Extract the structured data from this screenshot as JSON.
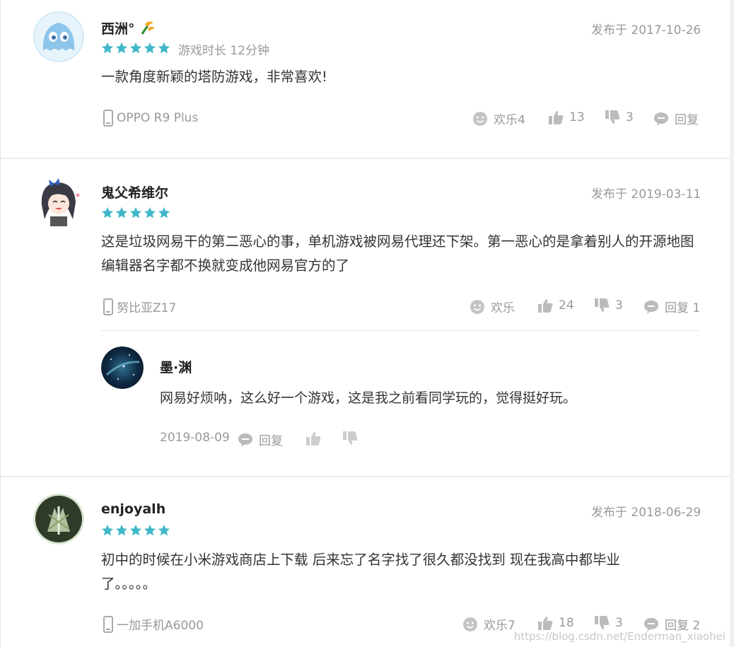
{
  "colors": {
    "star": "#3fb8c8",
    "muted": "#999999",
    "icon": "#bbbbbb"
  },
  "comments": [
    {
      "username": "西洲°",
      "date": "发布于 2017-10-26",
      "stars": 5,
      "playtime": "游戏时长 12分钟",
      "content": "一款角度新颖的塔防游戏，非常喜欢!",
      "device": "OPPO R9 Plus",
      "fun": "欢乐4",
      "likes": "13",
      "dislikes": "3",
      "reply": "回复"
    },
    {
      "username": "鬼父希维尔",
      "date": "发布于 2019-03-11",
      "stars": 5,
      "content": "这是垃圾网易干的第二恶心的事，单机游戏被网易代理还下架。第一恶心的是拿着别人的开源地图编辑器名字都不换就变成他网易官方的了",
      "device": "努比亚Z17",
      "fun": "欢乐",
      "likes": "24",
      "dislikes": "3",
      "reply": "回复 1",
      "sub_reply": {
        "username": "墨·渊",
        "content": "网易好烦呐，这么好一个游戏，这是我之前看同学玩的，觉得挺好玩。",
        "date": "2019-08-09",
        "reply": "回复"
      }
    },
    {
      "username": "enjoyalh",
      "date": "发布于 2018-06-29",
      "stars": 5,
      "content": "初中的时候在小米游戏商店上下载 后来忘了名字找了很久都没找到 现在我高中都毕业了。。。。。",
      "device": "一加手机A6000",
      "fun": "欢乐7",
      "likes": "18",
      "dislikes": "3",
      "reply": "回复 2"
    }
  ],
  "watermark": "https://blog.csdn.net/Enderman_xiaohei"
}
